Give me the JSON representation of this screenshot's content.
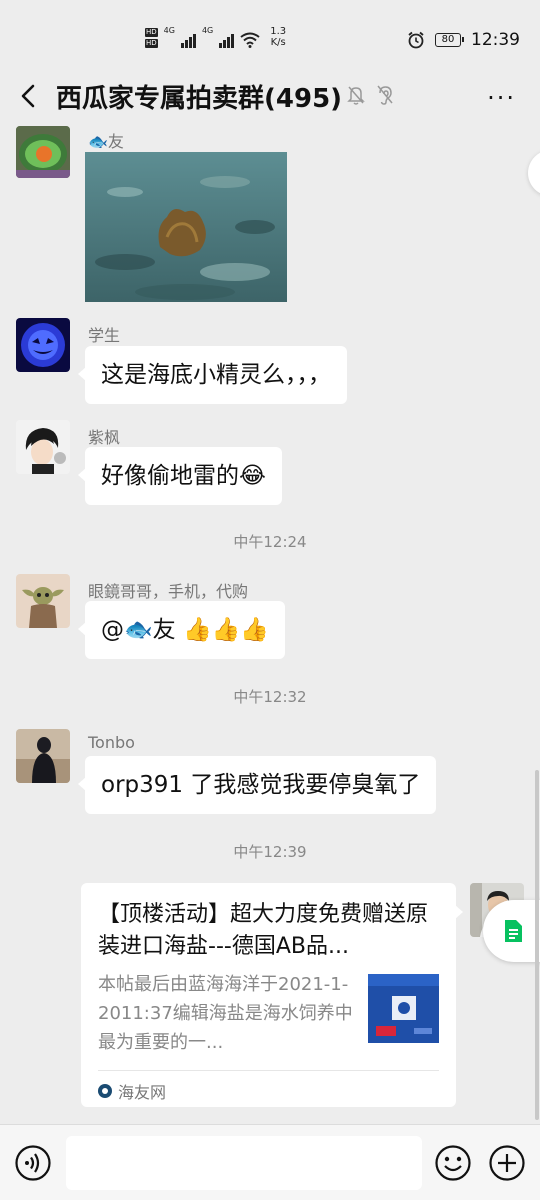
{
  "status_bar": {
    "sim1": "HD",
    "sim2": "HD",
    "net1": "4G",
    "net2": "4G",
    "speed_value": "1.3",
    "speed_unit": "K/s",
    "battery": "80",
    "time": "12:39"
  },
  "header": {
    "title": "西瓜家专属拍卖群(495)",
    "more": "···"
  },
  "messages": [
    {
      "sender": "🐟友",
      "type": "image"
    },
    {
      "sender": "学生",
      "text": "这是海底小精灵么，，，"
    },
    {
      "sender": "紫枫",
      "text": "好像偷地雷的😂"
    },
    {
      "sender": "眼鏡哥哥，手机，代购",
      "text": "@🐟友 👍👍👍"
    },
    {
      "sender": "Tonbo",
      "text": "orp391 了我感觉我要停臭氧了"
    }
  ],
  "timestamps": [
    "中午12:24",
    "中午12:32",
    "中午12:39"
  ],
  "link_card": {
    "title": "【顶楼活动】超大力度免费赠送原装进口海盐---德国AB品...",
    "description": "本帖最后由蓝海海洋于2021-1-2011:37编辑海盐是海水饲养中最为重要的一...",
    "source": "海友网"
  },
  "input_bar": {
    "placeholder": ""
  },
  "colors": {
    "background": "#ededed",
    "bubble": "#ffffff",
    "accent_green": "#07c160"
  }
}
